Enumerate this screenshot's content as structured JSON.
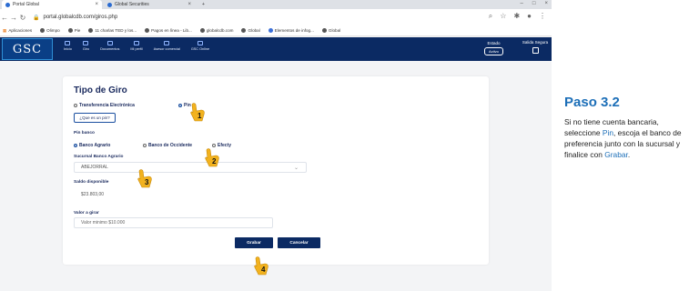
{
  "browser": {
    "tabs": [
      {
        "title": "Portal Global"
      },
      {
        "title": "Global Securities"
      }
    ],
    "url": "portal.globalcdb.com/giros.php",
    "bookmarks": [
      "Aplicaciones",
      "Olimpo",
      "Pie",
      "11 charlas TED y los...",
      "Pagos en línea - Lib...",
      "globalcdb.com",
      "Global",
      "Elementos de infog...",
      "Global"
    ]
  },
  "nav": {
    "logo": "GSC",
    "items": [
      "Inicio",
      "Giro",
      "Documentos",
      "Mi perfil",
      "Asesor comercial",
      "GSC Online"
    ],
    "estado_label": "Estado",
    "estado_value": "Activo",
    "salida_label": "Salida Segura"
  },
  "form": {
    "title": "Tipo de Giro",
    "option_transferencia": "Transferencia Electrónica",
    "option_pin": "Pin",
    "que_es_pin": "¿Que es un pin?",
    "pin_banco_label": "Pin banco",
    "bank_options": [
      "Banco Agrario",
      "Banco de Occidente",
      "Efecty"
    ],
    "sucursal_label": "Sucursal Banco Agrario",
    "sucursal_value": "ABEJORRAL",
    "saldo_label": "Saldo disponible",
    "saldo_value": "$23.803,00",
    "valor_label": "Valor a girar",
    "valor_placeholder": "Valor minimo $10.000",
    "grabar": "Grabar",
    "cancelar": "Cancelar"
  },
  "markers": [
    "1",
    "2",
    "3",
    "4"
  ],
  "instructions": {
    "title": "Paso 3.2",
    "text_a": "Si no tiene cuenta bancaria, seleccione ",
    "pin": "Pin",
    "text_b": ", escoja el banco de preferencia junto con la sucursal y finalice con ",
    "grabar": "Grabar",
    "text_c": "."
  },
  "colors": {
    "navy": "#0b2a63",
    "accent": "#1d6fb8",
    "hand": "#f2b21e"
  }
}
